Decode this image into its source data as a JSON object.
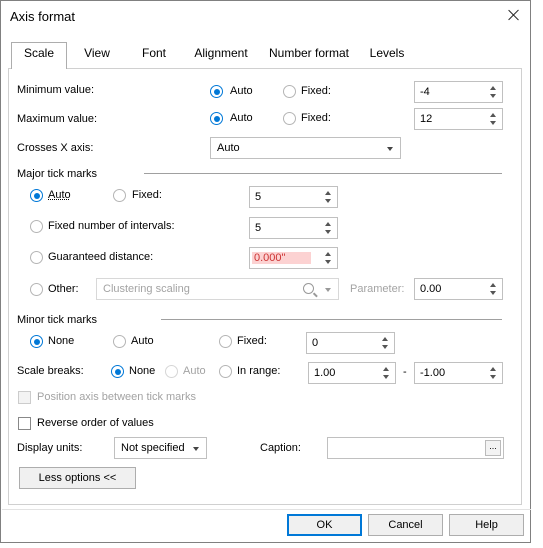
{
  "window": {
    "title": "Axis format"
  },
  "tabs": [
    "Scale",
    "View",
    "Font",
    "Alignment",
    "Number format",
    "Levels"
  ],
  "scale": {
    "minimum": {
      "label": "Minimum value:",
      "auto": "Auto",
      "fixed": "Fixed:",
      "value": "-4",
      "selected": "auto"
    },
    "maximum": {
      "label": "Maximum value:",
      "auto": "Auto",
      "fixed": "Fixed:",
      "value": "12",
      "selected": "auto"
    },
    "crosses": {
      "label": "Crosses X axis:",
      "value": "Auto"
    }
  },
  "major": {
    "heading": "Major tick marks",
    "auto": "Auto",
    "fixed": "Fixed:",
    "fixed_value": "5",
    "intervals_label": "Fixed number of intervals:",
    "intervals_value": "5",
    "distance_label": "Guaranteed distance:",
    "distance_value": "0.000\"",
    "other_label": "Other:",
    "other_placeholder": "Clustering scaling",
    "parameter_label": "Parameter:",
    "parameter_value": "0.00",
    "selected": "auto"
  },
  "minor": {
    "heading": "Minor tick marks",
    "none": "None",
    "auto": "Auto",
    "fixed": "Fixed:",
    "fixed_value": "0",
    "selected": "none"
  },
  "breaks": {
    "label": "Scale breaks:",
    "none": "None",
    "auto": "Auto",
    "range": "In range:",
    "from": "1.00",
    "dash": "-",
    "to": "-1.00",
    "selected": "none"
  },
  "position_between": {
    "label": "Position axis between tick marks",
    "checked": false,
    "enabled": false
  },
  "reverse_order": {
    "label": "Reverse order of values",
    "checked": false
  },
  "display_units": {
    "label": "Display units:",
    "value": "Not specified",
    "caption_label": "Caption:",
    "caption_value": "",
    "browse": "..."
  },
  "less_options": "Less options <<",
  "buttons": {
    "ok": "OK",
    "cancel": "Cancel",
    "help": "Help"
  },
  "colors": {
    "accent": "#0078d7",
    "error_bg": "#fcd2d2"
  }
}
